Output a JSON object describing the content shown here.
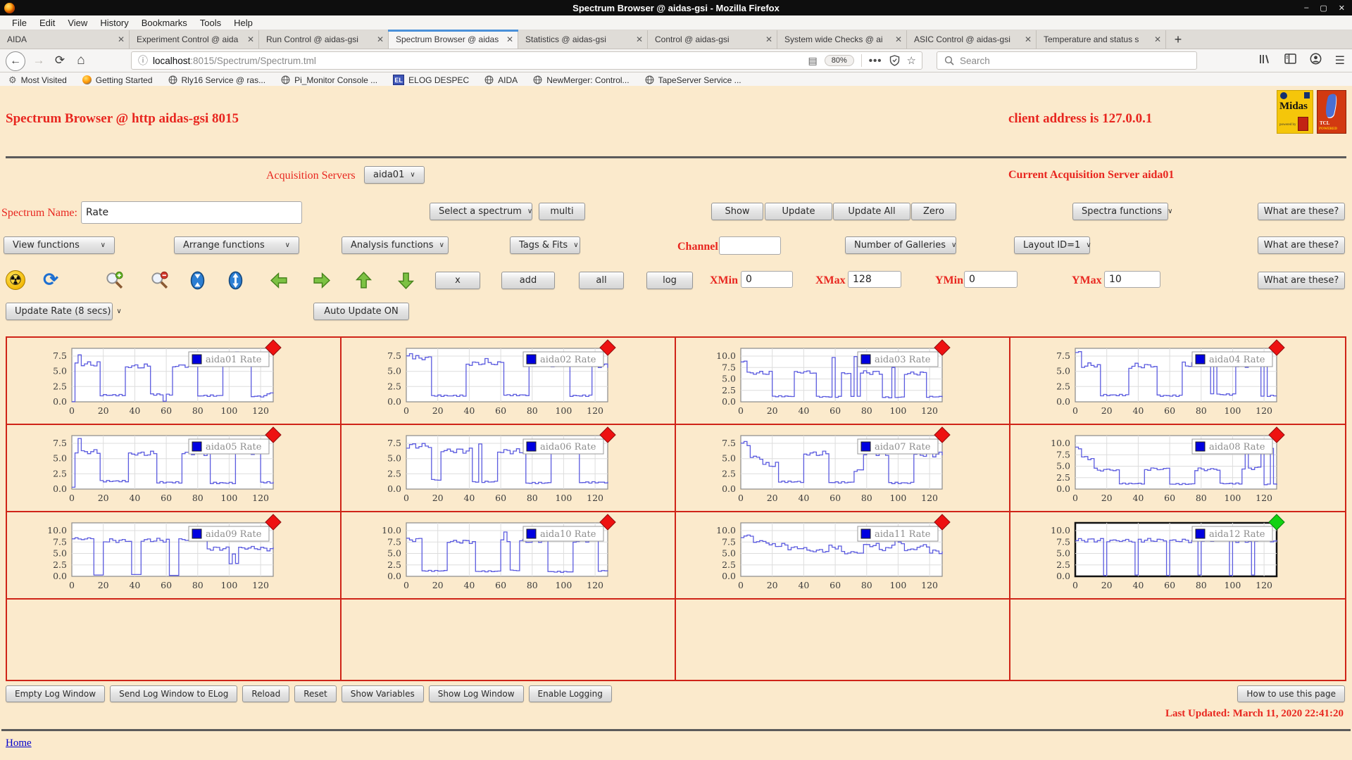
{
  "window": {
    "title": "Spectrum Browser @ aidas-gsi - Mozilla Firefox",
    "controls": [
      "–",
      "▢",
      "✕"
    ]
  },
  "menubar": [
    "File",
    "Edit",
    "View",
    "History",
    "Bookmarks",
    "Tools",
    "Help"
  ],
  "tabs": [
    {
      "label": "AIDA",
      "active": false
    },
    {
      "label": "Experiment Control @ aida",
      "active": false
    },
    {
      "label": "Run Control @ aidas-gsi",
      "active": false
    },
    {
      "label": "Spectrum Browser @ aidas",
      "active": true
    },
    {
      "label": "Statistics @ aidas-gsi",
      "active": false
    },
    {
      "label": "Control @ aidas-gsi",
      "active": false
    },
    {
      "label": "System wide Checks @ ai",
      "active": false
    },
    {
      "label": "ASIC Control @ aidas-gsi",
      "active": false
    },
    {
      "label": "Temperature and status s",
      "active": false
    }
  ],
  "new_tab_label": "+",
  "toolbar": {
    "url_host": "localhost",
    "url_path": ":8015/Spectrum/Spectrum.tml",
    "zoom": "80%",
    "search_placeholder": "Search"
  },
  "bookmarks": [
    {
      "label": "Most Visited",
      "icon": "gear"
    },
    {
      "label": "Getting Started",
      "icon": "firefox"
    },
    {
      "label": "Rly16 Service @ ras...",
      "icon": "globe"
    },
    {
      "label": "Pi_Monitor Console ...",
      "icon": "globe"
    },
    {
      "label": "ELOG DESPEC",
      "icon": "elog"
    },
    {
      "label": "AIDA",
      "icon": "globe"
    },
    {
      "label": "NewMerger: Control...",
      "icon": "globe"
    },
    {
      "label": "TapeServer Service ...",
      "icon": "globe"
    }
  ],
  "page": {
    "title": "Spectrum Browser @ http aidas-gsi 8015",
    "client_address": "client address is 127.0.0.1",
    "acq_label": "Acquisition Servers",
    "acq_value": "aida01",
    "current_server": "Current Acquisition Server aida01",
    "spectrum_name_label": "Spectrum Name:",
    "spectrum_name_value": "Rate",
    "select_spectrum": "Select a spectrum",
    "multi": "multi",
    "buttons": {
      "show": "Show",
      "update": "Update",
      "update_all": "Update All",
      "zero": "Zero"
    },
    "spectra_functions": "Spectra functions",
    "what_are_these": "What are these?",
    "dropdowns": {
      "view": "View functions",
      "arrange": "Arrange functions",
      "analysis": "Analysis functions",
      "tags": "Tags & Fits",
      "galleries": "Number of Galleries",
      "layout": "Layout ID=1",
      "update_rate": "Update Rate (8 secs)"
    },
    "channel_label": "Channel:",
    "icon_toolbar": [
      "radiation",
      "refresh",
      "zoom-in",
      "zoom-out",
      "collapse-vertical",
      "expand-vertical",
      "arrow-left",
      "arrow-right",
      "arrow-up",
      "arrow-down"
    ],
    "small_buttons": [
      "x",
      "add",
      "all",
      "log"
    ],
    "axis_fields": [
      {
        "label": "XMin",
        "value": "0"
      },
      {
        "label": "XMax",
        "value": "128"
      },
      {
        "label": "YMin",
        "value": "0"
      },
      {
        "label": "YMax",
        "value": "10"
      }
    ],
    "auto_update": "Auto Update ON",
    "bottom_buttons": [
      "Empty Log Window",
      "Send Log Window to ELog",
      "Reload",
      "Reset",
      "Show Variables",
      "Show Log Window",
      "Enable Logging"
    ],
    "how_to": "How to use this page",
    "last_updated": "Last Updated: March 11, 2020 22:41:20",
    "home": "Home"
  },
  "chart_data": {
    "type": "line",
    "line_style": "step",
    "line_color": "#5b5bdf",
    "xticks": [
      0,
      20,
      40,
      60,
      80,
      100,
      120
    ],
    "xmax": 128,
    "grid": true,
    "legend_position": "top-right",
    "charts": [
      {
        "legend": "aida01 Rate",
        "yticks": [
          0,
          2.5,
          5,
          7.5
        ],
        "marker": "red",
        "selected": false,
        "segments": [
          [
            0,
            2,
            0
          ],
          [
            2,
            17,
            6.2
          ],
          [
            17,
            33,
            1.1
          ],
          [
            33,
            50,
            5.8
          ],
          [
            50,
            57,
            1.2
          ],
          [
            57,
            60,
            0.1
          ],
          [
            60,
            64,
            1.2
          ],
          [
            64,
            80,
            5.9
          ],
          [
            80,
            96,
            1.0
          ],
          [
            96,
            113,
            6.0
          ],
          [
            113,
            124,
            0.9
          ],
          [
            124,
            129,
            1.4
          ]
        ],
        "spikes": [
          [
            4,
            7.7
          ],
          [
            104,
            8.2
          ],
          [
            110,
            7.8
          ]
        ]
      },
      {
        "legend": "aida02 Rate",
        "yticks": [
          0,
          2.5,
          5,
          7.5
        ],
        "marker": "red",
        "selected": false,
        "segments": [
          [
            0,
            15,
            7.2
          ],
          [
            15,
            38,
            1.0
          ],
          [
            38,
            62,
            6.3
          ],
          [
            62,
            77,
            1.1
          ],
          [
            77,
            103,
            6.1
          ],
          [
            103,
            118,
            1.0
          ],
          [
            118,
            129,
            5.9
          ]
        ],
        "spikes": [
          [
            2,
            7.9
          ],
          [
            50,
            7.1
          ]
        ]
      },
      {
        "legend": "aida03 Rate",
        "yticks": [
          0,
          2.5,
          5,
          7.5,
          10
        ],
        "marker": "red",
        "selected": false,
        "segments": [
          [
            0,
            4,
            8.9
          ],
          [
            4,
            20,
            6.3
          ],
          [
            20,
            34,
            1.2
          ],
          [
            34,
            48,
            6.5
          ],
          [
            48,
            64,
            1.1
          ],
          [
            64,
            70,
            6.3
          ],
          [
            70,
            76,
            1.3
          ],
          [
            76,
            90,
            6.4
          ],
          [
            90,
            104,
            1.0
          ],
          [
            104,
            118,
            6.2
          ],
          [
            118,
            129,
            1.1
          ]
        ],
        "spikes": [
          [
            58,
            9.7
          ],
          [
            72,
            9.9
          ],
          [
            96,
            7.5
          ]
        ]
      },
      {
        "legend": "aida04 Rate",
        "yticks": [
          0,
          2.5,
          5,
          7.5
        ],
        "marker": "red",
        "selected": false,
        "segments": [
          [
            0,
            3,
            7.9
          ],
          [
            3,
            16,
            6.0
          ],
          [
            16,
            34,
            1.1
          ],
          [
            34,
            52,
            5.9
          ],
          [
            52,
            68,
            1.0
          ],
          [
            68,
            86,
            6.1
          ],
          [
            86,
            102,
            1.2
          ],
          [
            102,
            118,
            6.0
          ],
          [
            118,
            129,
            1.0
          ]
        ],
        "spikes": [
          [
            88,
            7.7
          ],
          [
            120,
            7.9
          ]
        ]
      },
      {
        "legend": "aida05 Rate",
        "yticks": [
          0,
          2.5,
          5,
          7.5
        ],
        "marker": "red",
        "selected": false,
        "segments": [
          [
            0,
            2,
            0.3
          ],
          [
            2,
            18,
            6.1
          ],
          [
            18,
            36,
            1.3
          ],
          [
            36,
            54,
            5.8
          ],
          [
            54,
            70,
            1.1
          ],
          [
            70,
            88,
            5.9
          ],
          [
            88,
            104,
            1.0
          ],
          [
            104,
            120,
            6.0
          ],
          [
            120,
            129,
            1.1
          ]
        ],
        "spikes": [
          [
            4,
            8.3
          ],
          [
            106,
            7.6
          ]
        ]
      },
      {
        "legend": "aida06 Rate",
        "yticks": [
          0,
          2.5,
          5,
          7.5
        ],
        "marker": "red",
        "selected": false,
        "segments": [
          [
            0,
            16,
            7.1
          ],
          [
            16,
            21,
            1.5
          ],
          [
            21,
            42,
            6.3
          ],
          [
            42,
            58,
            1.2
          ],
          [
            58,
            76,
            6.2
          ],
          [
            76,
            92,
            1.0
          ],
          [
            92,
            110,
            6.1
          ],
          [
            110,
            129,
            1.1
          ]
        ],
        "spikes": [
          [
            46,
            7.4
          ],
          [
            96,
            7.8
          ]
        ]
      },
      {
        "legend": "aida07 Rate",
        "yticks": [
          0,
          2.5,
          5,
          7.5
        ],
        "marker": "red",
        "selected": false,
        "segments": [
          [
            0,
            6,
            7.3
          ],
          [
            6,
            14,
            5.2
          ],
          [
            14,
            24,
            4.0
          ],
          [
            24,
            40,
            1.2
          ],
          [
            40,
            56,
            5.8
          ],
          [
            56,
            72,
            1.1
          ],
          [
            72,
            78,
            3.0
          ],
          [
            78,
            94,
            5.9
          ],
          [
            94,
            110,
            1.0
          ],
          [
            110,
            129,
            5.7
          ]
        ],
        "spikes": [
          [
            2,
            7.8
          ]
        ]
      },
      {
        "legend": "aida08 Rate",
        "yticks": [
          0,
          2.5,
          5,
          7.5,
          10
        ],
        "marker": "red",
        "selected": false,
        "segments": [
          [
            0,
            4,
            9.2
          ],
          [
            4,
            12,
            6.8
          ],
          [
            12,
            28,
            4.2
          ],
          [
            28,
            44,
            1.2
          ],
          [
            44,
            60,
            4.4
          ],
          [
            60,
            76,
            1.1
          ],
          [
            76,
            92,
            4.3
          ],
          [
            92,
            106,
            1.2
          ],
          [
            106,
            120,
            4.6
          ],
          [
            120,
            129,
            1.0
          ]
        ],
        "spikes": [
          [
            108,
            9.6
          ],
          [
            118,
            9.4
          ],
          [
            124,
            8.9
          ]
        ]
      },
      {
        "legend": "aida09 Rate",
        "yticks": [
          0,
          2.5,
          5,
          7.5,
          10
        ],
        "marker": "red",
        "selected": false,
        "segments": [
          [
            0,
            14,
            8.2
          ],
          [
            14,
            20,
            0.3
          ],
          [
            20,
            38,
            7.8
          ],
          [
            38,
            44,
            0.4
          ],
          [
            44,
            62,
            7.9
          ],
          [
            62,
            68,
            0.2
          ],
          [
            68,
            86,
            8.0
          ],
          [
            86,
            100,
            6.1
          ],
          [
            100,
            106,
            2.8
          ],
          [
            106,
            120,
            6.2
          ],
          [
            120,
            129,
            6.0
          ]
        ],
        "spikes": [
          [
            102,
            4.9
          ]
        ]
      },
      {
        "legend": "aida10 Rate",
        "yticks": [
          0,
          2.5,
          5,
          7.5,
          10
        ],
        "marker": "red",
        "selected": false,
        "segments": [
          [
            0,
            10,
            8.0
          ],
          [
            10,
            26,
            1.2
          ],
          [
            26,
            44,
            7.6
          ],
          [
            44,
            60,
            1.1
          ],
          [
            60,
            66,
            7.8
          ],
          [
            66,
            72,
            1.3
          ],
          [
            72,
            90,
            7.7
          ],
          [
            90,
            106,
            1.0
          ],
          [
            106,
            122,
            7.8
          ],
          [
            122,
            129,
            1.2
          ]
        ],
        "spikes": [
          [
            62,
            9.7
          ]
        ]
      },
      {
        "legend": "aida11 Rate",
        "yticks": [
          0,
          2.5,
          5,
          7.5,
          10
        ],
        "marker": "red",
        "selected": false,
        "segments": [
          [
            0,
            8,
            8.8
          ],
          [
            8,
            18,
            7.6
          ],
          [
            18,
            30,
            6.8
          ],
          [
            30,
            42,
            6.2
          ],
          [
            42,
            56,
            5.6
          ],
          [
            56,
            64,
            6.4
          ],
          [
            64,
            78,
            5.2
          ],
          [
            78,
            88,
            6.8
          ],
          [
            88,
            96,
            6.0
          ],
          [
            96,
            104,
            7.2
          ],
          [
            104,
            112,
            5.8
          ],
          [
            112,
            120,
            6.6
          ],
          [
            120,
            129,
            5.4
          ]
        ],
        "spikes": [
          [
            98,
            8.9
          ]
        ]
      },
      {
        "legend": "aida12 Rate",
        "yticks": [
          0,
          2.5,
          5,
          7.5,
          10
        ],
        "marker": "green",
        "selected": true,
        "segments": [
          [
            0,
            18,
            7.9
          ],
          [
            18,
            20,
            0.2
          ],
          [
            20,
            38,
            7.8
          ],
          [
            38,
            40,
            0.3
          ],
          [
            40,
            58,
            7.9
          ],
          [
            58,
            60,
            0.2
          ],
          [
            60,
            78,
            7.8
          ],
          [
            78,
            80,
            0.3
          ],
          [
            80,
            98,
            7.9
          ],
          [
            98,
            100,
            0.2
          ],
          [
            100,
            112,
            7.8
          ],
          [
            112,
            114,
            0.3
          ],
          [
            114,
            129,
            7.7
          ]
        ],
        "spikes": [
          [
            116,
            8.4
          ],
          [
            122,
            8.2
          ]
        ]
      }
    ]
  }
}
